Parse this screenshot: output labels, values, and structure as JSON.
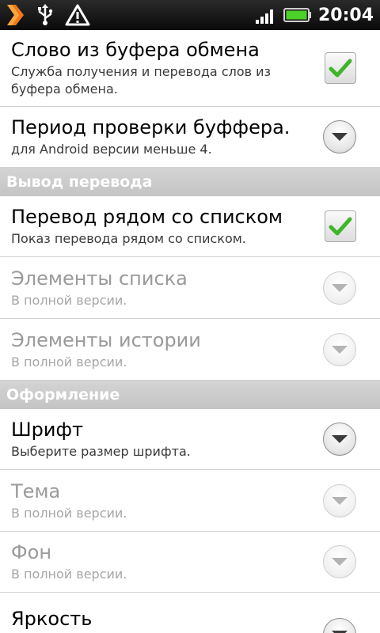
{
  "status_bar": {
    "time": "20:04",
    "icons": [
      "app-notification-icon",
      "usb-icon",
      "warning-icon",
      "signal-icon",
      "battery-icon"
    ]
  },
  "colors": {
    "checkmark": "#3fb52a",
    "category_bg": "#c8c8c8",
    "divider": "#d2d2d2",
    "disabled_text": "#9a9a9a"
  },
  "items": {
    "clipboard_word": {
      "title": "Слово из буфера обмена",
      "summary": "Служба получения и перевода слов из буфера обмена.",
      "checked": true
    },
    "check_period": {
      "title": "Период проверки буффера.",
      "summary": "для Android версии меньше 4."
    },
    "translation_near_list": {
      "title": "Перевод рядом со списком",
      "summary": "Показ перевода рядом со списком.",
      "checked": true
    },
    "list_elements": {
      "title": "Элементы списка",
      "summary": "В полной версии."
    },
    "history_elements": {
      "title": "Элементы истории",
      "summary": "В полной версии."
    },
    "font": {
      "title": "Шрифт",
      "summary": "Выберите размер шрифта."
    },
    "theme": {
      "title": "Тема",
      "summary": "В полной версии."
    },
    "background": {
      "title": "Фон",
      "summary": "В полной версии."
    },
    "brightness": {
      "title": "Яркость"
    }
  },
  "categories": {
    "translation_output": "Вывод перевода",
    "appearance": "Оформление"
  }
}
